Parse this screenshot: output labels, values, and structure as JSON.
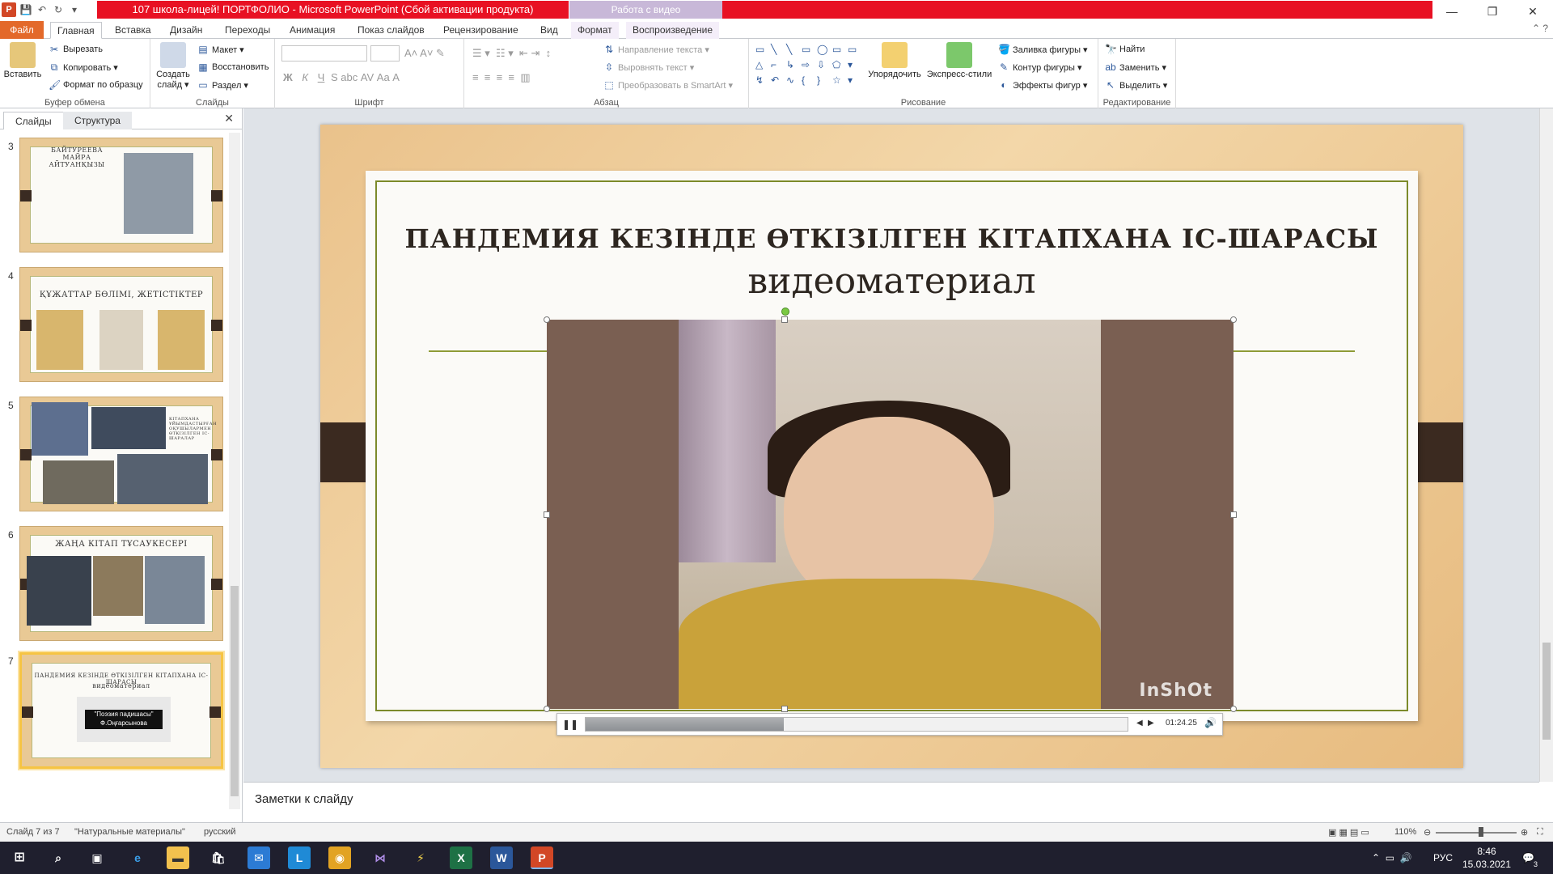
{
  "window": {
    "title": "107 школа-лицей! ПОРТФОЛИО  -  Microsoft PowerPoint (Сбой активации продукта)",
    "context_tab_title": "Работа с видео",
    "controls": [
      "—",
      "❐",
      "✕"
    ]
  },
  "ribbon_tabs": [
    "Файл",
    "Главная",
    "Вставка",
    "Дизайн",
    "Переходы",
    "Анимация",
    "Показ слайдов",
    "Рецензирование",
    "Вид",
    "Формат",
    "Воспроизведение"
  ],
  "ribbon": {
    "clipboard": {
      "label": "Буфер обмена",
      "paste": "Вставить",
      "cut": "Вырезать",
      "copy": "Копировать ▾",
      "format_painter": "Формат по образцу"
    },
    "slides": {
      "label": "Слайды",
      "new_slide": "Создать слайд ▾",
      "layout": "Макет ▾",
      "reset": "Восстановить",
      "section": "Раздел ▾"
    },
    "font": {
      "label": "Шрифт"
    },
    "paragraph": {
      "label": "Абзац",
      "text_direction": "Направление текста ▾",
      "align_text": "Выровнять текст ▾",
      "smartart": "Преобразовать в SmartArt ▾"
    },
    "drawing": {
      "label": "Рисование",
      "arrange": "Упорядочить",
      "quick_styles": "Экспресс-стили",
      "fill": "Заливка фигуры ▾",
      "outline": "Контур фигуры ▾",
      "effects": "Эффекты фигур ▾"
    },
    "editing": {
      "label": "Редактирование",
      "find": "Найти",
      "replace": "Заменить ▾",
      "select": "Выделить ▾"
    }
  },
  "pane": {
    "tabs": [
      "Слайды",
      "Структура"
    ],
    "thumbs": [
      {
        "num": "3",
        "title": "БАЙТУРЕЕВА МАЙРА АЙТУАНҚЫЗЫ"
      },
      {
        "num": "4",
        "title": "ҚҰЖАТТАР  БӨЛІМІ,  ЖЕТІСТІКТЕР"
      },
      {
        "num": "5",
        "title": "КІТАПХАНА ҰЙЫМДАСТЫРҒАН ОҚУШЫЛАРМЕН ӨТКІЗІЛГЕН ІС-ШАРАЛАР"
      },
      {
        "num": "6",
        "title": "ЖАҢА КІТАП ТҰСАУКЕСЕРІ"
      },
      {
        "num": "7",
        "title": "ПАНДЕМИЯ  КЕЗІНДЕ ӨТКІЗІЛГЕН  КІТАПХАНА  ІС-ШАРАСЫ",
        "subtitle": "видеоматериал",
        "caption_1": "\"Поэзия падишасы\"",
        "caption_2": "Ф.Оңғарсынова"
      }
    ]
  },
  "slide": {
    "title": "ПАНДЕМИЯ КЕЗІНДЕ ӨТКІЗІЛГЕН КІТАПХАНА ІС-ШАРАСЫ",
    "subtitle": "видеоматериал",
    "watermark": "InShOt"
  },
  "player": {
    "time": "01:24.25",
    "progress": 0.365
  },
  "notes": {
    "placeholder": "Заметки к слайду"
  },
  "status": {
    "slide": "Слайд 7 из 7",
    "theme": "\"Натуральные материалы\"",
    "lang": "русский",
    "zoom": "110%"
  },
  "taskbar": {
    "lang": "РУС",
    "time": "8:46",
    "date": "15.03.2021",
    "notifications": "3"
  }
}
